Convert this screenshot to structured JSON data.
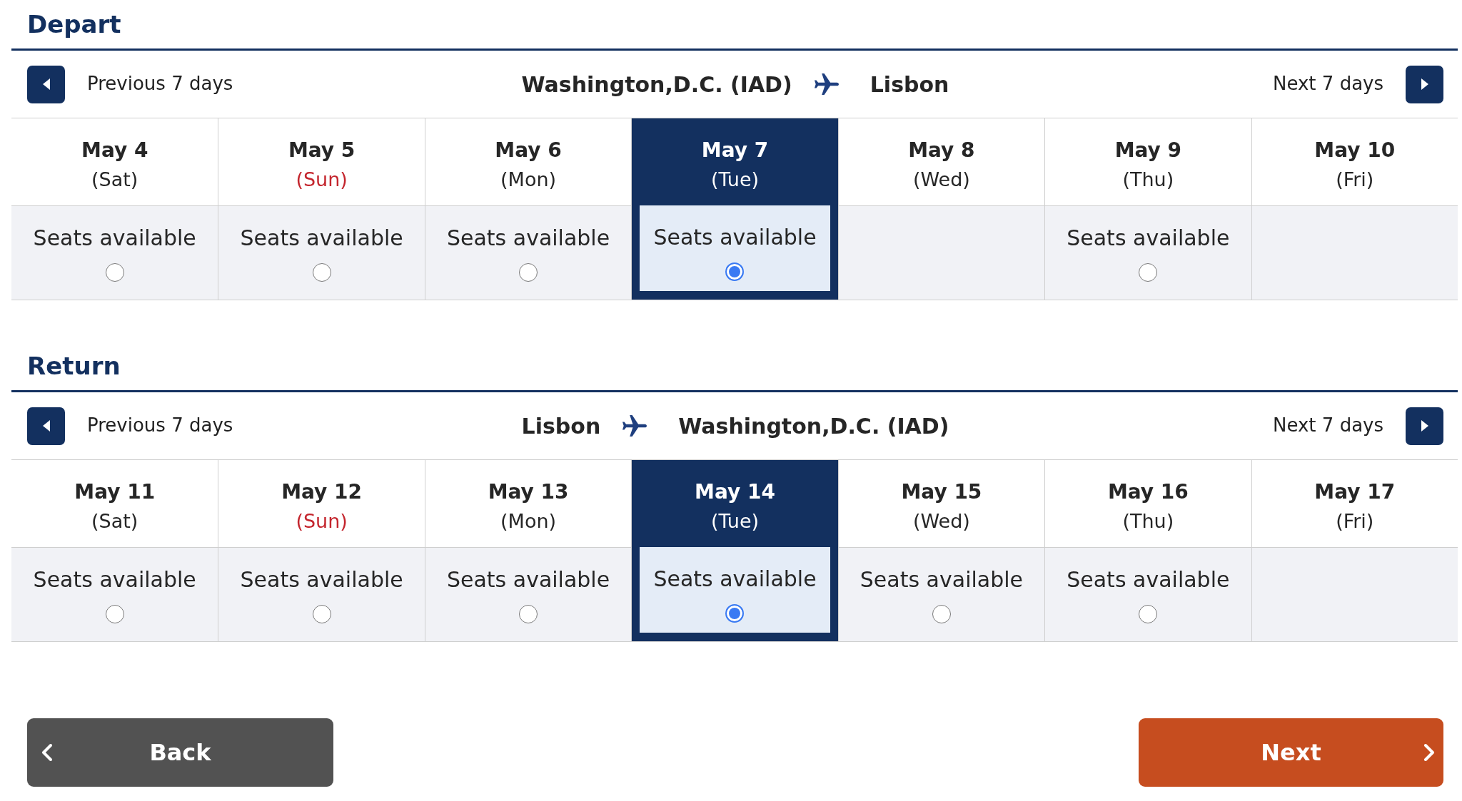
{
  "sections": [
    {
      "title": "Depart",
      "previous": "Previous 7 days",
      "route": {
        "from": "Washington,D.C. (IAD)",
        "to": "Lisbon"
      },
      "next": "Next 7 days",
      "days": [
        {
          "date": "May 4",
          "weekday": "(Sat)",
          "sunday": false,
          "seats": "Seats available",
          "selected": false
        },
        {
          "date": "May 5",
          "weekday": "(Sun)",
          "sunday": true,
          "seats": "Seats available",
          "selected": false
        },
        {
          "date": "May 6",
          "weekday": "(Mon)",
          "sunday": false,
          "seats": "Seats available",
          "selected": false
        },
        {
          "date": "May 7",
          "weekday": "(Tue)",
          "sunday": false,
          "seats": "Seats available",
          "selected": true
        },
        {
          "date": "May 8",
          "weekday": "(Wed)",
          "sunday": false,
          "selected": false
        },
        {
          "date": "May 9",
          "weekday": "(Thu)",
          "sunday": false,
          "seats": "Seats available",
          "selected": false
        },
        {
          "date": "May 10",
          "weekday": "(Fri)",
          "sunday": false,
          "selected": false
        }
      ]
    },
    {
      "title": "Return",
      "previous": "Previous 7 days",
      "route": {
        "from": "Lisbon",
        "to": "Washington,D.C. (IAD)"
      },
      "next": "Next 7 days",
      "days": [
        {
          "date": "May 11",
          "weekday": "(Sat)",
          "sunday": false,
          "seats": "Seats available",
          "selected": false
        },
        {
          "date": "May 12",
          "weekday": "(Sun)",
          "sunday": true,
          "seats": "Seats available",
          "selected": false
        },
        {
          "date": "May 13",
          "weekday": "(Mon)",
          "sunday": false,
          "seats": "Seats available",
          "selected": false
        },
        {
          "date": "May 14",
          "weekday": "(Tue)",
          "sunday": false,
          "seats": "Seats available",
          "selected": true
        },
        {
          "date": "May 15",
          "weekday": "(Wed)",
          "sunday": false,
          "seats": "Seats available",
          "selected": false
        },
        {
          "date": "May 16",
          "weekday": "(Thu)",
          "sunday": false,
          "seats": "Seats available",
          "selected": false
        },
        {
          "date": "May 17",
          "weekday": "(Fri)",
          "sunday": false,
          "selected": false
        }
      ]
    }
  ],
  "buttons": [
    {
      "kind": "back",
      "label": "Back"
    },
    {
      "kind": "next",
      "label": "Next"
    }
  ]
}
